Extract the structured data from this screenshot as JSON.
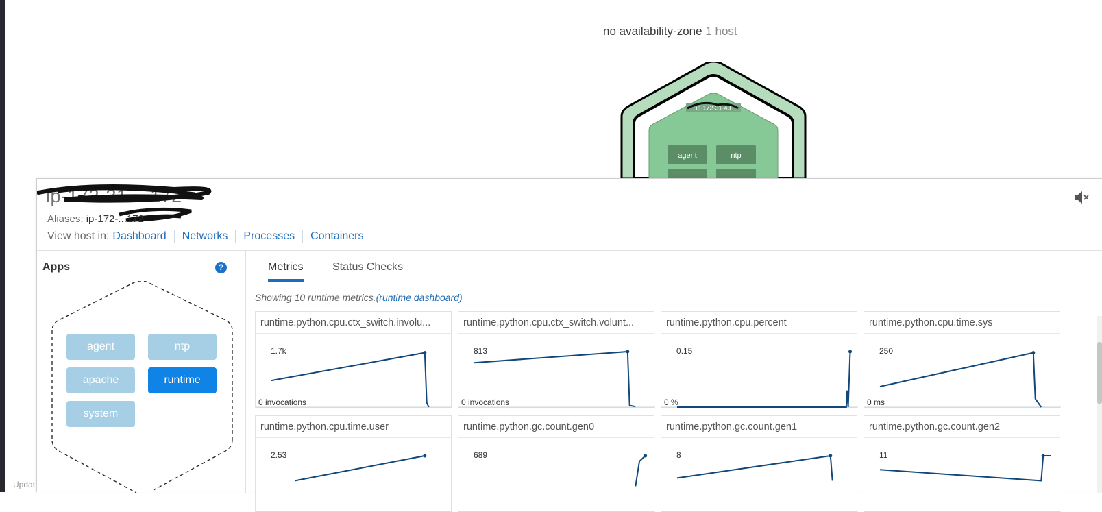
{
  "zone": {
    "name": "no availability-zone",
    "count": "1 host"
  },
  "hexmap": {
    "host_label": "ip-172-31-43",
    "apps": [
      "agent",
      "ntp"
    ]
  },
  "footer": {
    "updated": "Updat"
  },
  "host": {
    "title": "ip-172-31-...172",
    "aliases_label": "Aliases:",
    "aliases_value": "ip-172-...172",
    "view_host_label": "View host in:",
    "view_links": [
      "Dashboard",
      "Networks",
      "Processes",
      "Containers"
    ],
    "mute_icon": "speaker-muted-icon"
  },
  "apps": {
    "title": "Apps",
    "help_icon": "?",
    "items": [
      {
        "label": "agent",
        "active": false
      },
      {
        "label": "ntp",
        "active": false
      },
      {
        "label": "apache",
        "active": false
      },
      {
        "label": "runtime",
        "active": true
      },
      {
        "label": "system",
        "active": false
      }
    ]
  },
  "tabs": [
    {
      "label": "Metrics",
      "active": true
    },
    {
      "label": "Status Checks",
      "active": false
    }
  ],
  "showing": {
    "text": "Showing 10 runtime metrics.",
    "link": "(runtime dashboard)"
  },
  "colors": {
    "line": "#11477a",
    "accent": "#1f6eb8",
    "app_active": "#0f83e6",
    "app_inactive": "#a6cfe6",
    "hex_outer": "#b4dcbd",
    "hex_inner": "#86c996",
    "hex_app": "#5b8d66"
  },
  "metrics": [
    {
      "name": "runtime.python.cpu.ctx_switch.involu...",
      "ymax_label": "1.7k",
      "ymin_label": "0 invocations",
      "points": [
        [
          0.08,
          0.48
        ],
        [
          0.86,
          0.98
        ],
        [
          0.87,
          0.08
        ],
        [
          0.88,
          0.0
        ]
      ]
    },
    {
      "name": "runtime.python.cpu.ctx_switch.volunt...",
      "ymax_label": "813",
      "ymin_label": "0 invocations",
      "points": [
        [
          0.08,
          0.8
        ],
        [
          0.86,
          1.0
        ],
        [
          0.87,
          0.03
        ],
        [
          0.9,
          0.01
        ]
      ]
    },
    {
      "name": "runtime.python.cpu.percent",
      "ymax_label": "0.15",
      "ymin_label": "0 %",
      "points": [
        [
          0.08,
          0.0
        ],
        [
          0.94,
          0.0
        ],
        [
          0.945,
          0.3
        ],
        [
          0.95,
          0.0
        ],
        [
          0.96,
          1.0
        ]
      ]
    },
    {
      "name": "runtime.python.cpu.time.sys",
      "ymax_label": "250",
      "ymin_label": "0 ms",
      "points": [
        [
          0.08,
          0.37
        ],
        [
          0.86,
          0.98
        ],
        [
          0.87,
          0.15
        ],
        [
          0.9,
          0.0
        ]
      ]
    },
    {
      "name": "runtime.python.cpu.time.user",
      "ymax_label": "2.53",
      "ymin_label": "",
      "points": [
        [
          0.2,
          0.55
        ],
        [
          0.86,
          1.0
        ]
      ]
    },
    {
      "name": "runtime.python.gc.count.gen0",
      "ymax_label": "689",
      "ymin_label": "",
      "points": [
        [
          0.9,
          0.45
        ],
        [
          0.92,
          0.9
        ],
        [
          0.95,
          1.0
        ]
      ]
    },
    {
      "name": "runtime.python.gc.count.gen1",
      "ymax_label": "8",
      "ymin_label": "",
      "points": [
        [
          0.08,
          0.6
        ],
        [
          0.86,
          1.0
        ],
        [
          0.87,
          0.55
        ]
      ]
    },
    {
      "name": "runtime.python.gc.count.gen2",
      "ymax_label": "11",
      "ymin_label": "",
      "points": [
        [
          0.08,
          0.75
        ],
        [
          0.9,
          0.55
        ],
        [
          0.91,
          1.0
        ],
        [
          0.95,
          1.0
        ]
      ]
    }
  ]
}
